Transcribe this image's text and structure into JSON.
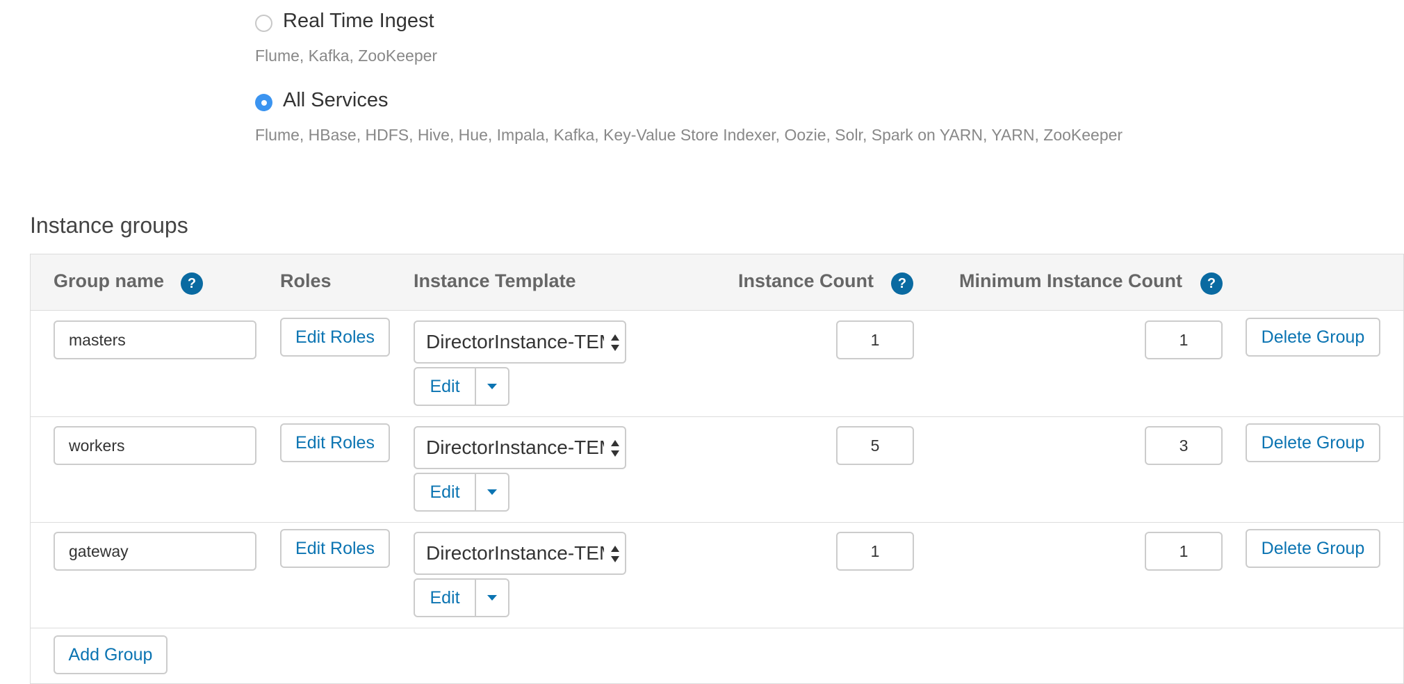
{
  "service_options": [
    {
      "label": "Real Time Ingest",
      "services": "Flume, Kafka, ZooKeeper",
      "selected": false
    },
    {
      "label": "All Services",
      "services": "Flume, HBase, HDFS, Hive, Hue, Impala, Kafka, Key-Value Store Indexer, Oozie, Solr, Spark on YARN, YARN, ZooKeeper",
      "selected": true
    }
  ],
  "instance_groups": {
    "title": "Instance groups",
    "headers": {
      "group_name": "Group name",
      "roles": "Roles",
      "instance_template": "Instance Template",
      "instance_count": "Instance Count",
      "minimum_instance_count": "Minimum Instance Count",
      "help_glyph": "?"
    },
    "rows": [
      {
        "group_name": "masters",
        "roles_button": "Edit Roles",
        "template": "DirectorInstance-TEMPLATE",
        "edit_label": "Edit",
        "instance_count": "1",
        "minimum_instance_count": "1",
        "delete_button": "Delete Group"
      },
      {
        "group_name": "workers",
        "roles_button": "Edit Roles",
        "template": "DirectorInstance-TEMPLATE",
        "edit_label": "Edit",
        "instance_count": "5",
        "minimum_instance_count": "3",
        "delete_button": "Delete Group"
      },
      {
        "group_name": "gateway",
        "roles_button": "Edit Roles",
        "template": "DirectorInstance-TEMPLATE",
        "edit_label": "Edit",
        "instance_count": "1",
        "minimum_instance_count": "1",
        "delete_button": "Delete Group"
      }
    ],
    "add_group_button": "Add Group"
  },
  "colors": {
    "accent": "#0b74b2",
    "help_badge": "#0a6aa1",
    "radio_selected": "#3b94f0",
    "header_background": "#f5f5f5",
    "border": "#dcdcdc"
  },
  "icons": {
    "help": "help-icon",
    "select_arrows": "select-arrows-icon",
    "dropdown_caret": "caret-down-icon"
  }
}
